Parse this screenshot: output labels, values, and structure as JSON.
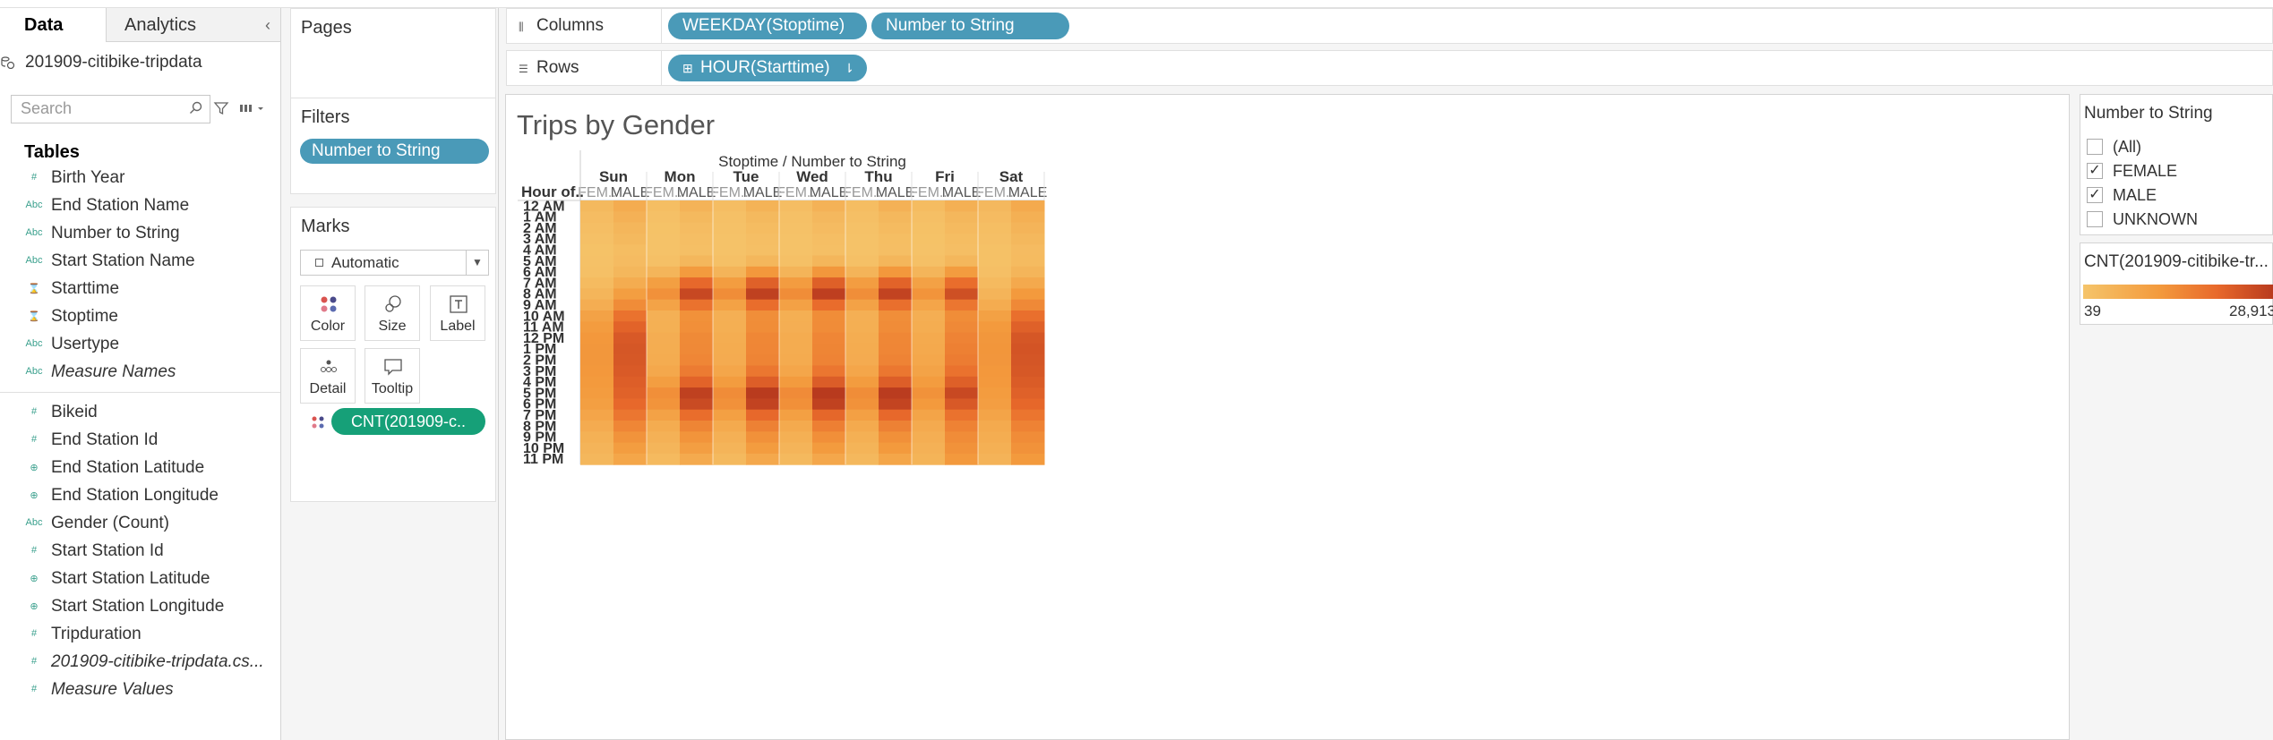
{
  "left_pane": {
    "tab_data": "Data",
    "tab_analytics": "Analytics",
    "datasource": "201909-citibike-tripdata",
    "search_placeholder": "Search",
    "tables_header": "Tables",
    "fields": [
      {
        "icon": "#",
        "label": "Birth Year",
        "italic": false
      },
      {
        "icon": "Abc",
        "label": "End Station Name",
        "italic": false
      },
      {
        "icon": "Abc",
        "label": "Number to String",
        "italic": false
      },
      {
        "icon": "Abc",
        "label": "Start Station Name",
        "italic": false
      },
      {
        "icon": "date",
        "label": "Starttime",
        "italic": false
      },
      {
        "icon": "date",
        "label": "Stoptime",
        "italic": false
      },
      {
        "icon": "Abc",
        "label": "Usertype",
        "italic": false
      },
      {
        "icon": "Abc",
        "label": "Measure Names",
        "italic": true
      },
      {
        "icon": "#",
        "label": "Bikeid",
        "italic": false
      },
      {
        "icon": "#",
        "label": "End Station Id",
        "italic": false
      },
      {
        "icon": "globe",
        "label": "End Station Latitude",
        "italic": false
      },
      {
        "icon": "globe",
        "label": "End Station Longitude",
        "italic": false
      },
      {
        "icon": "Abc",
        "label": "Gender (Count)",
        "italic": false
      },
      {
        "icon": "#",
        "label": "Start Station Id",
        "italic": false
      },
      {
        "icon": "globe",
        "label": "Start Station Latitude",
        "italic": false
      },
      {
        "icon": "globe",
        "label": "Start Station Longitude",
        "italic": false
      },
      {
        "icon": "#",
        "label": "Tripduration",
        "italic": false
      },
      {
        "icon": "#",
        "label": "201909-citibike-tripdata.cs...",
        "italic": true
      },
      {
        "icon": "#",
        "label": "Measure Values",
        "italic": true
      }
    ]
  },
  "cards": {
    "pages_title": "Pages",
    "filters_title": "Filters",
    "filter_pill": "Number to String",
    "marks_title": "Marks",
    "mark_type": "Automatic",
    "mark_buttons": {
      "color": "Color",
      "size": "Size",
      "label": "Label",
      "detail": "Detail",
      "tooltip": "Tooltip"
    },
    "cnt_pill": "CNT(201909-c.."
  },
  "shelves": {
    "columns_label": "Columns",
    "rows_label": "Rows",
    "columns_pills": [
      "WEEKDAY(Stoptime)",
      "Number to String"
    ],
    "rows_pill": "HOUR(Starttime)"
  },
  "viz": {
    "title": "Trips by Gender",
    "column_header": "Stoptime / Number to String",
    "row_header": "Hour of..",
    "days": [
      "Sun",
      "Mon",
      "Tue",
      "Wed",
      "Thu",
      "Fri",
      "Sat"
    ],
    "genders": [
      "FEM..",
      "MALE"
    ],
    "hours": [
      "12 AM",
      "1 AM",
      "2 AM",
      "3 AM",
      "4 AM",
      "5 AM",
      "6 AM",
      "7 AM",
      "8 AM",
      "9 AM",
      "10 AM",
      "11 AM",
      "12 PM",
      "1 PM",
      "2 PM",
      "3 PM",
      "4 PM",
      "5 PM",
      "6 PM",
      "7 PM",
      "8 PM",
      "9 PM",
      "10 PM",
      "11 PM"
    ]
  },
  "chart_data": {
    "type": "heatmap",
    "title": "Trips by Gender",
    "x_header": "Stoptime / Number to String",
    "y_header": "Hour of..",
    "columns": [
      "Sun FEMALE",
      "Sun MALE",
      "Mon FEMALE",
      "Mon MALE",
      "Tue FEMALE",
      "Tue MALE",
      "Wed FEMALE",
      "Wed MALE",
      "Thu FEMALE",
      "Thu MALE",
      "Fri FEMALE",
      "Fri MALE",
      "Sat FEMALE",
      "Sat MALE"
    ],
    "rows": [
      "12 AM",
      "1 AM",
      "2 AM",
      "3 AM",
      "4 AM",
      "5 AM",
      "6 AM",
      "7 AM",
      "8 AM",
      "9 AM",
      "10 AM",
      "11 AM",
      "12 PM",
      "1 PM",
      "2 PM",
      "3 PM",
      "4 PM",
      "5 PM",
      "6 PM",
      "7 PM",
      "8 PM",
      "9 PM",
      "10 PM",
      "11 PM"
    ],
    "color_min": 39,
    "color_max": 28913,
    "color_scale": [
      "#f5c46a",
      "#f39a3d",
      "#e8692b",
      "#b83a1e"
    ],
    "values": [
      [
        2600,
        5600,
        1500,
        3900,
        1600,
        4000,
        1600,
        4100,
        1700,
        4300,
        1900,
        4700,
        2700,
        6000
      ],
      [
        1800,
        4300,
        900,
        2500,
        1000,
        2600,
        1000,
        2700,
        1100,
        2900,
        1200,
        3100,
        2000,
        4700
      ],
      [
        1300,
        3300,
        600,
        1800,
        700,
        1900,
        700,
        2000,
        700,
        2100,
        800,
        2300,
        1500,
        3600
      ],
      [
        900,
        2500,
        400,
        1300,
        400,
        1300,
        500,
        1400,
        500,
        1500,
        600,
        1700,
        1100,
        2800
      ],
      [
        600,
        1700,
        400,
        1200,
        400,
        1200,
        400,
        1200,
        400,
        1300,
        500,
        1400,
        800,
        2000
      ],
      [
        700,
        2000,
        900,
        3000,
        1000,
        3100,
        1000,
        3200,
        1000,
        3200,
        1000,
        3100,
        800,
        2200
      ],
      [
        1000,
        3000,
        3500,
        9500,
        3700,
        10000,
        3700,
        10200,
        3700,
        10000,
        3400,
        9200,
        1200,
        3500
      ],
      [
        2100,
        5600,
        8500,
        19500,
        9000,
        21000,
        9100,
        21200,
        8900,
        20500,
        8000,
        18500,
        2400,
        6200
      ],
      [
        3500,
        8800,
        11500,
        26000,
        12200,
        27500,
        12300,
        27800,
        12000,
        27000,
        10800,
        24500,
        3700,
        9600
      ],
      [
        5200,
        12500,
        7500,
        17500,
        7900,
        18500,
        8000,
        18700,
        7800,
        18200,
        7200,
        16800,
        5500,
        13000
      ],
      [
        7800,
        17500,
        4600,
        11500,
        4800,
        12000,
        4900,
        12200,
        4800,
        12000,
        5000,
        12300,
        8100,
        18200
      ],
      [
        9300,
        20500,
        4700,
        11800,
        4900,
        12300,
        5000,
        12500,
        4900,
        12400,
        5400,
        13000,
        9600,
        21000
      ],
      [
        10000,
        22500,
        5200,
        12800,
        5400,
        13300,
        5500,
        13500,
        5400,
        13400,
        6000,
        14200,
        10300,
        23000
      ],
      [
        10300,
        23000,
        5300,
        13000,
        5500,
        13500,
        5600,
        13700,
        5500,
        13600,
        6300,
        14800,
        10500,
        23500
      ],
      [
        10200,
        22800,
        5500,
        13500,
        5700,
        14000,
        5800,
        14200,
        5700,
        14100,
        6700,
        15500,
        10400,
        23200
      ],
      [
        10000,
        22300,
        6500,
        15800,
        6800,
        16500,
        6900,
        16700,
        6800,
        16600,
        7600,
        17500,
        10100,
        22800
      ],
      [
        9600,
        21500,
        8800,
        20500,
        9300,
        21500,
        9400,
        21800,
        9200,
        21500,
        9300,
        21200,
        9800,
        22000
      ],
      [
        9200,
        20800,
        11800,
        27500,
        12500,
        28800,
        12600,
        28913,
        12300,
        28500,
        11200,
        25800,
        9300,
        21000
      ],
      [
        8600,
        19500,
        10800,
        25500,
        11500,
        27000,
        11600,
        27300,
        11300,
        26800,
        9600,
        22500,
        8700,
        19700
      ],
      [
        7200,
        16800,
        7800,
        18500,
        8300,
        19500,
        8400,
        19800,
        8200,
        19400,
        7400,
        17500,
        7300,
        17000
      ],
      [
        5700,
        13500,
        5600,
        13800,
        6000,
        14600,
        6100,
        14900,
        6000,
        14600,
        5900,
        14300,
        6100,
        14300
      ],
      [
        4500,
        11000,
        4300,
        10800,
        4600,
        11500,
        4700,
        11800,
        4700,
        11700,
        5000,
        12500,
        5300,
        12500
      ],
      [
        3700,
        9000,
        3400,
        8700,
        3600,
        9200,
        3700,
        9500,
        3800,
        9600,
        4400,
        11200,
        4700,
        11300
      ],
      [
        3000,
        7000,
        2300,
        6000,
        2500,
        6400,
        2600,
        6700,
        2800,
        7000,
        3800,
        9800,
        3900,
        9600
      ]
    ]
  },
  "legends": {
    "filter_title": "Number to String",
    "filter_items": [
      {
        "label": "(All)",
        "checked": false
      },
      {
        "label": "FEMALE",
        "checked": true
      },
      {
        "label": "MALE",
        "checked": true
      },
      {
        "label": "UNKNOWN",
        "checked": false
      }
    ],
    "color_title": "CNT(201909-citibike-tr...",
    "color_min_label": "39",
    "color_max_label": "28,913"
  }
}
